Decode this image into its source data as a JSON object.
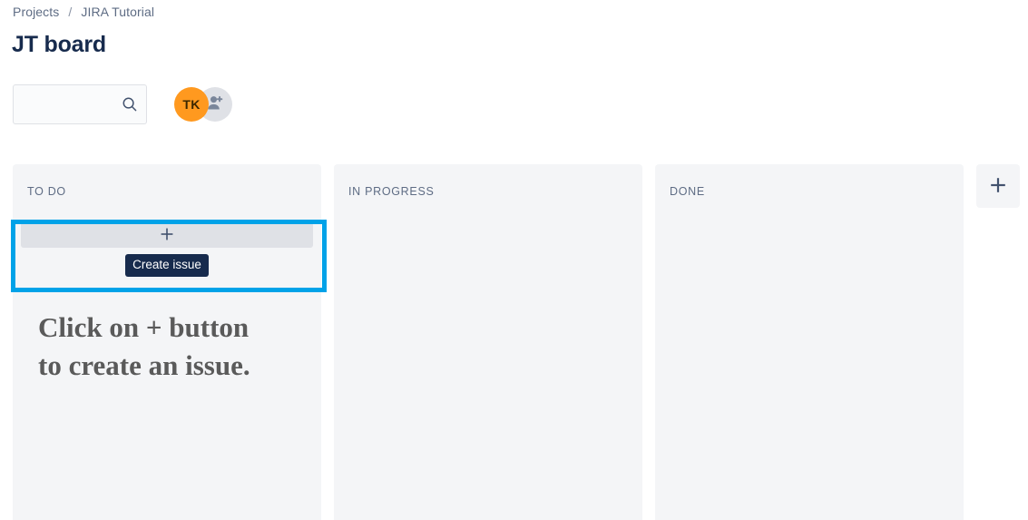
{
  "breadcrumb": {
    "items": [
      {
        "label": "Projects"
      },
      {
        "label": "JIRA Tutorial"
      }
    ],
    "separator": "/"
  },
  "header": {
    "title": "JT board"
  },
  "toolbar": {
    "search": {
      "value": "",
      "placeholder": "",
      "icon": "search-icon"
    },
    "avatars": [
      {
        "initials": "TK",
        "type": "user-avatar",
        "color": "#ff991f"
      },
      {
        "initials": "",
        "type": "add-people-avatar",
        "icon": "person-add-icon",
        "color": "#dfe1e6"
      }
    ]
  },
  "board": {
    "columns": [
      {
        "title": "TO DO"
      },
      {
        "title": "IN PROGRESS"
      },
      {
        "title": "DONE"
      }
    ],
    "create_issue": {
      "icon": "plus-icon",
      "tooltip": "Create issue"
    },
    "add_column": {
      "icon": "plus-icon",
      "label": ""
    }
  },
  "annotation": {
    "text": "Click on + button\nto create an issue.",
    "color": "#5a5a5a"
  },
  "highlight": {
    "color": "#00a2e8"
  }
}
